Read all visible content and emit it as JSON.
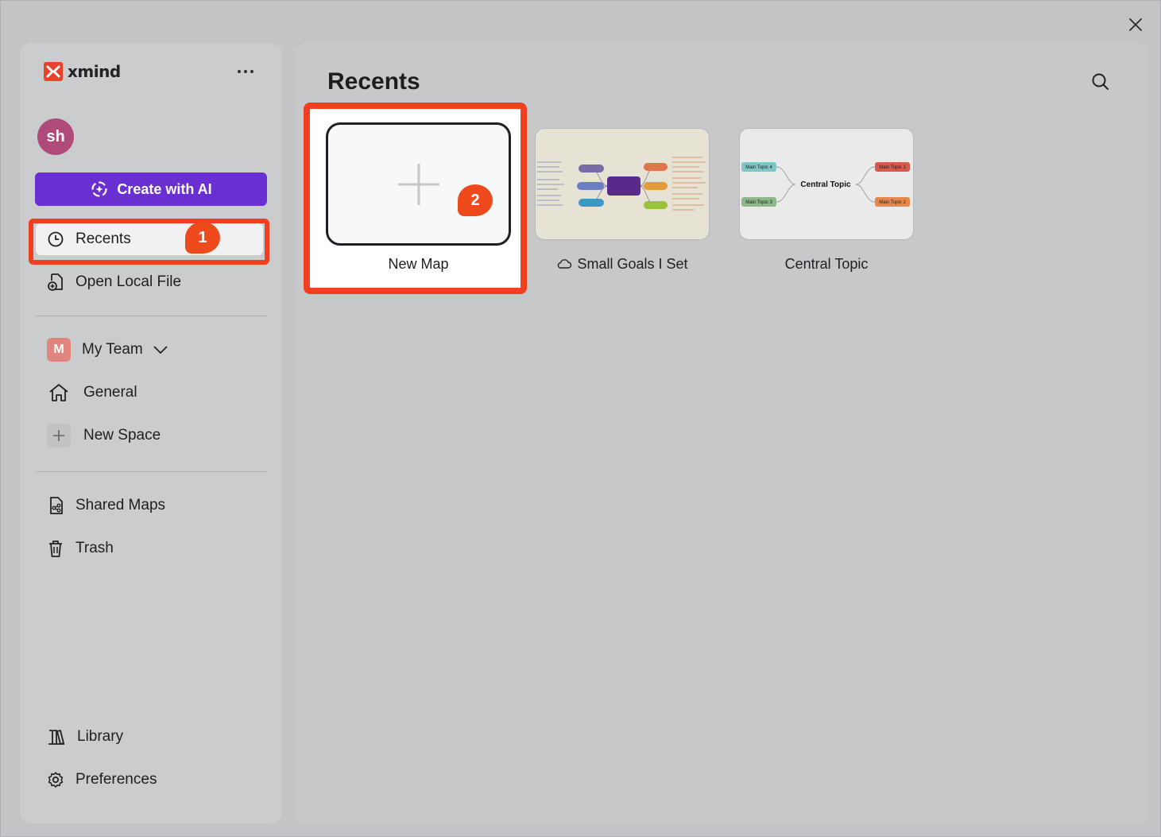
{
  "app": {
    "name": "xmind"
  },
  "sidebar": {
    "avatar_initials": "sh",
    "create_ai_label": "Create with AI",
    "recents_label": "Recents",
    "open_local_label": "Open Local File",
    "team_badge": "M",
    "team_label": "My Team",
    "general_label": "General",
    "new_space_label": "New Space",
    "shared_maps_label": "Shared Maps",
    "trash_label": "Trash",
    "library_label": "Library",
    "preferences_label": "Preferences"
  },
  "annotations": {
    "step1": "1",
    "step2": "2",
    "highlight_color": "#f0401f"
  },
  "main": {
    "title": "Recents",
    "cards": [
      {
        "label": "New Map"
      },
      {
        "label": "Small Goals I Set",
        "cloud": true
      },
      {
        "label": "Central Topic"
      }
    ],
    "thumb_central": {
      "center": "Central Topic",
      "topics": [
        "Main Topic 4",
        "Main Topic 1",
        "Main Topic 3",
        "Main Topic 2"
      ]
    }
  },
  "colors": {
    "accent_purple": "#6a2fd0",
    "avatar": "#b04a78",
    "team_badge": "#e0857d"
  },
  "icons": [
    "close-icon",
    "more-icon",
    "sparkle-icon",
    "clock-icon",
    "file-add-icon",
    "chevron-down-icon",
    "home-icon",
    "plus-icon",
    "shared-file-icon",
    "trash-icon",
    "library-icon",
    "gear-icon",
    "search-icon",
    "cloud-icon"
  ]
}
